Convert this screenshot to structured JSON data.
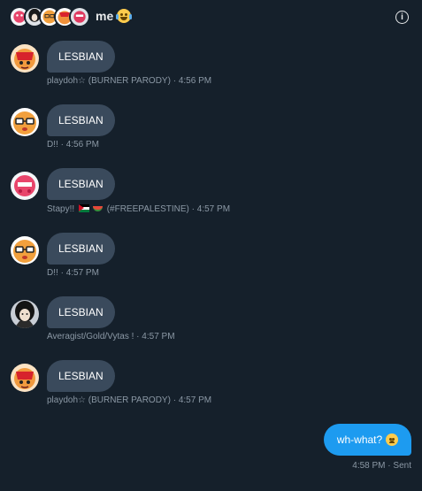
{
  "header": {
    "title": "me",
    "title_emoji": "tears-of-joy-emoji",
    "info_icon": "info-icon",
    "avatars": [
      "pink-character-avatar",
      "dark-hair-avatar",
      "orange-character-avatar",
      "red-character-avatar",
      "pink-character-avatar"
    ]
  },
  "messages": [
    {
      "text": "LESBIAN",
      "author": "playdoh☆ (BURNER PARODY)",
      "time": "4:56 PM",
      "avatar": "red-bear-avatar"
    },
    {
      "text": "LESBIAN",
      "author": "D!!",
      "time": "4:56 PM",
      "avatar": "glasses-avatar"
    },
    {
      "text": "LESBIAN",
      "author_prefix": "Stapy!!",
      "author_suffix": "(#FREEPALESTINE)",
      "time": "4:57 PM",
      "avatar": "pink-blob-avatar"
    },
    {
      "text": "LESBIAN",
      "author": "D!!",
      "time": "4:57 PM",
      "avatar": "glasses-avatar"
    },
    {
      "text": "LESBIAN",
      "author": "Averagist/Gold/Vytas !",
      "time": "4:57 PM",
      "avatar": "dark-hair-avatar"
    },
    {
      "text": "LESBIAN",
      "author": "playdoh☆ (BURNER PARODY)",
      "time": "4:57 PM",
      "avatar": "red-bear-avatar"
    }
  ],
  "outgoing": {
    "text": "wh-what?",
    "emoji": "worried-face-emoji",
    "time": "4:58 PM",
    "status": "Sent"
  },
  "separator": "·",
  "colors": {
    "background": "#15202b",
    "incoming_bubble": "#3a4a5c",
    "outgoing_bubble": "#1d9bf0",
    "meta_text": "#8b98a5"
  }
}
